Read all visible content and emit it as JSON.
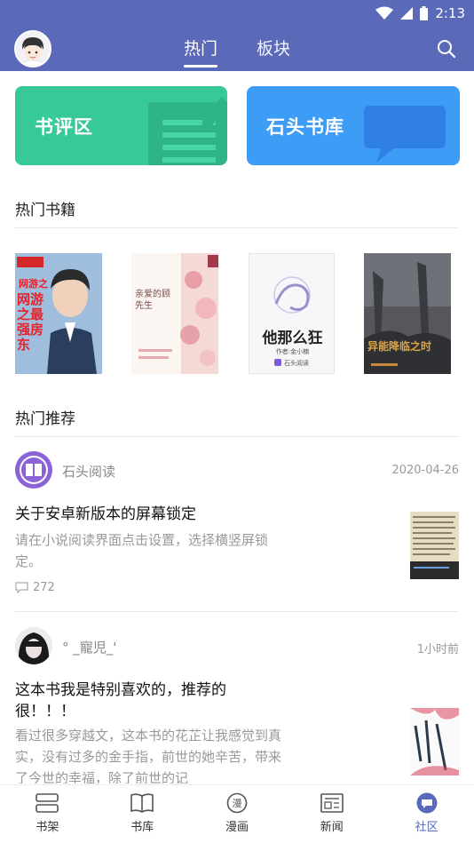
{
  "status": {
    "time": "2:13"
  },
  "header": {
    "tabs": [
      {
        "label": "热门"
      },
      {
        "label": "板块"
      }
    ]
  },
  "banners": {
    "review": {
      "label": "书评区"
    },
    "library": {
      "label": "石头书库"
    }
  },
  "hot_books": {
    "title": "热门书籍",
    "books": [
      {
        "cover_text": "网游之最强房东"
      },
      {
        "cover_text": "亲爱的顾先生"
      },
      {
        "cover_text": "他那么狂",
        "author": "作者:金小楠",
        "publisher": "石头阅读"
      },
      {
        "cover_text": "异能降临之时"
      }
    ]
  },
  "recommend": {
    "title": "热门推荐",
    "posts": [
      {
        "author": "石头阅读",
        "date": "2020-04-26",
        "title": "关于安卓新版本的屏幕锁定",
        "body": "请在小说阅读界面点击设置，选择横竖屏锁定。",
        "comments": "272"
      },
      {
        "author": "° _寵児_'",
        "date": "1小时前",
        "title": "这本书我是特别喜欢的，推荐的很！！！",
        "body": "看过很多穿越文，这本书的花芷让我感觉到真实，没有过多的金手指，前世的她辛苦，带来了今世的幸福，除了前世的记"
      }
    ]
  },
  "bottom_nav": [
    {
      "label": "书架"
    },
    {
      "label": "书库"
    },
    {
      "label": "漫画"
    },
    {
      "label": "新闻"
    },
    {
      "label": "社区"
    }
  ],
  "colors": {
    "primary": "#5b6ab8",
    "review": "#37c99a",
    "library": "#3d9cf6"
  }
}
